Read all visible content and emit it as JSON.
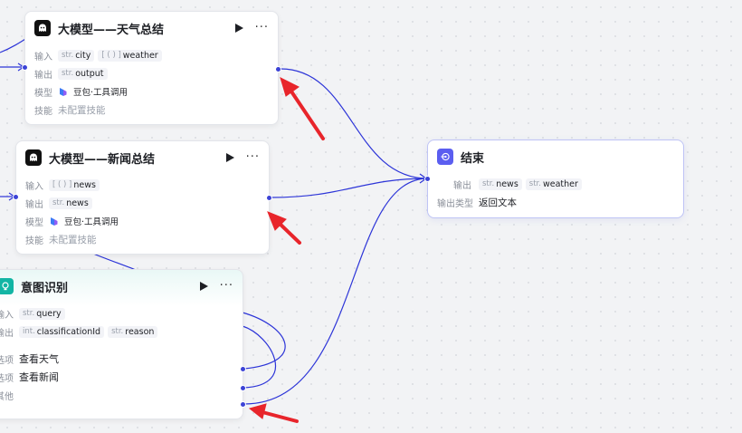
{
  "colors": {
    "accent": "#3c43d6",
    "edge": "#2d35d8",
    "annotation": "#e8252b"
  },
  "nodes": {
    "weather_llm": {
      "title": "大模型——天气总结",
      "icon": "llm-ghost-icon",
      "input_label": "输入",
      "inputs": [
        {
          "type": "str.",
          "name": "city"
        },
        {
          "type": "[ ( ) ]",
          "name": "weather"
        }
      ],
      "output_label": "输出",
      "outputs": [
        {
          "type": "str.",
          "name": "output"
        }
      ],
      "model_label": "模型",
      "model": "豆包·工具调用",
      "skill_label": "技能",
      "skill": "未配置技能"
    },
    "news_llm": {
      "title": "大模型——新闻总结",
      "icon": "llm-ghost-icon",
      "input_label": "输入",
      "inputs": [
        {
          "type": "[ ( ) ]",
          "name": "news"
        }
      ],
      "output_label": "输出",
      "outputs": [
        {
          "type": "str.",
          "name": "news"
        }
      ],
      "model_label": "模型",
      "model": "豆包·工具调用",
      "skill_label": "技能",
      "skill": "未配置技能"
    },
    "intent": {
      "title": "意图识别",
      "icon": "intent-bulb-icon",
      "input_label": "输入",
      "inputs": [
        {
          "type": "str.",
          "name": "query"
        }
      ],
      "output_label": "输出",
      "outputs": [
        {
          "type": "int.",
          "name": "classificationId"
        },
        {
          "type": "str.",
          "name": "reason"
        }
      ],
      "option_label": "选项",
      "options": [
        "查看天气",
        "查看新闻"
      ],
      "other_label": "其他"
    },
    "end": {
      "title": "结束",
      "icon": "end-icon",
      "output_label": "输出",
      "outputs": [
        {
          "type": "str.",
          "name": "news"
        },
        {
          "type": "str.",
          "name": "weather"
        }
      ],
      "output_type_label": "输出类型",
      "output_type": "返回文本"
    }
  }
}
